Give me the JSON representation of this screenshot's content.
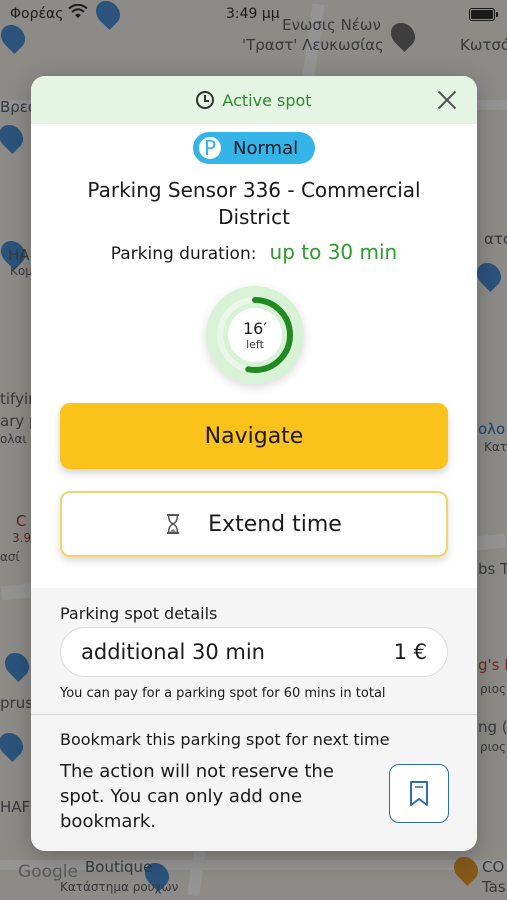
{
  "status_bar": {
    "carrier": "Φορέας",
    "time": "3:49 μμ"
  },
  "map": {
    "labels": [
      "Ενωσις Νέων",
      "'Τραστ' Λευκωσίας",
      "Κωτσό",
      "Βρεσ",
      "HA",
      "Κομ",
      "tifyir",
      "ary p",
      "ολαι",
      "C",
      "3.9",
      "ασί",
      "prus",
      "HAF",
      "ολο",
      "Κατ",
      "bs T",
      "g's B",
      "ριος",
      "ng (",
      "ριος",
      "Boutique",
      "Κατάστημα ρούχων",
      "CO",
      "Tas",
      "ατο"
    ],
    "google": "Google"
  },
  "header": {
    "title": "Active spot"
  },
  "badge": {
    "icon_letter": "P",
    "label": "Normal"
  },
  "spot": {
    "name": "Parking Sensor 336 - Commercial District",
    "duration_label": "Parking duration:",
    "duration_value": "up to 30 min"
  },
  "timer": {
    "minutes": "16′",
    "label": "left",
    "fraction_remaining": 0.53
  },
  "buttons": {
    "navigate": "Navigate",
    "extend": "Extend time"
  },
  "details": {
    "title": "Parking spot details",
    "option_label": "additional 30 min",
    "option_price": "1 €",
    "note": "You can pay for a parking spot for 60 mins in total"
  },
  "bookmark": {
    "title": "Bookmark this parking spot for next time",
    "text": "The action will not reserve the spot. You can only add one bookmark."
  },
  "colors": {
    "accent_green": "#2e9b2e",
    "header_bg": "#e4f6e3",
    "navigate_yellow": "#fbc21b",
    "badge_blue": "#35b4e8",
    "bookmark_blue": "#2d6ea8"
  },
  "icons": {
    "header": "clock-icon",
    "close": "close-icon",
    "extend": "hourglass-icon",
    "bookmark": "bookmark-icon"
  }
}
